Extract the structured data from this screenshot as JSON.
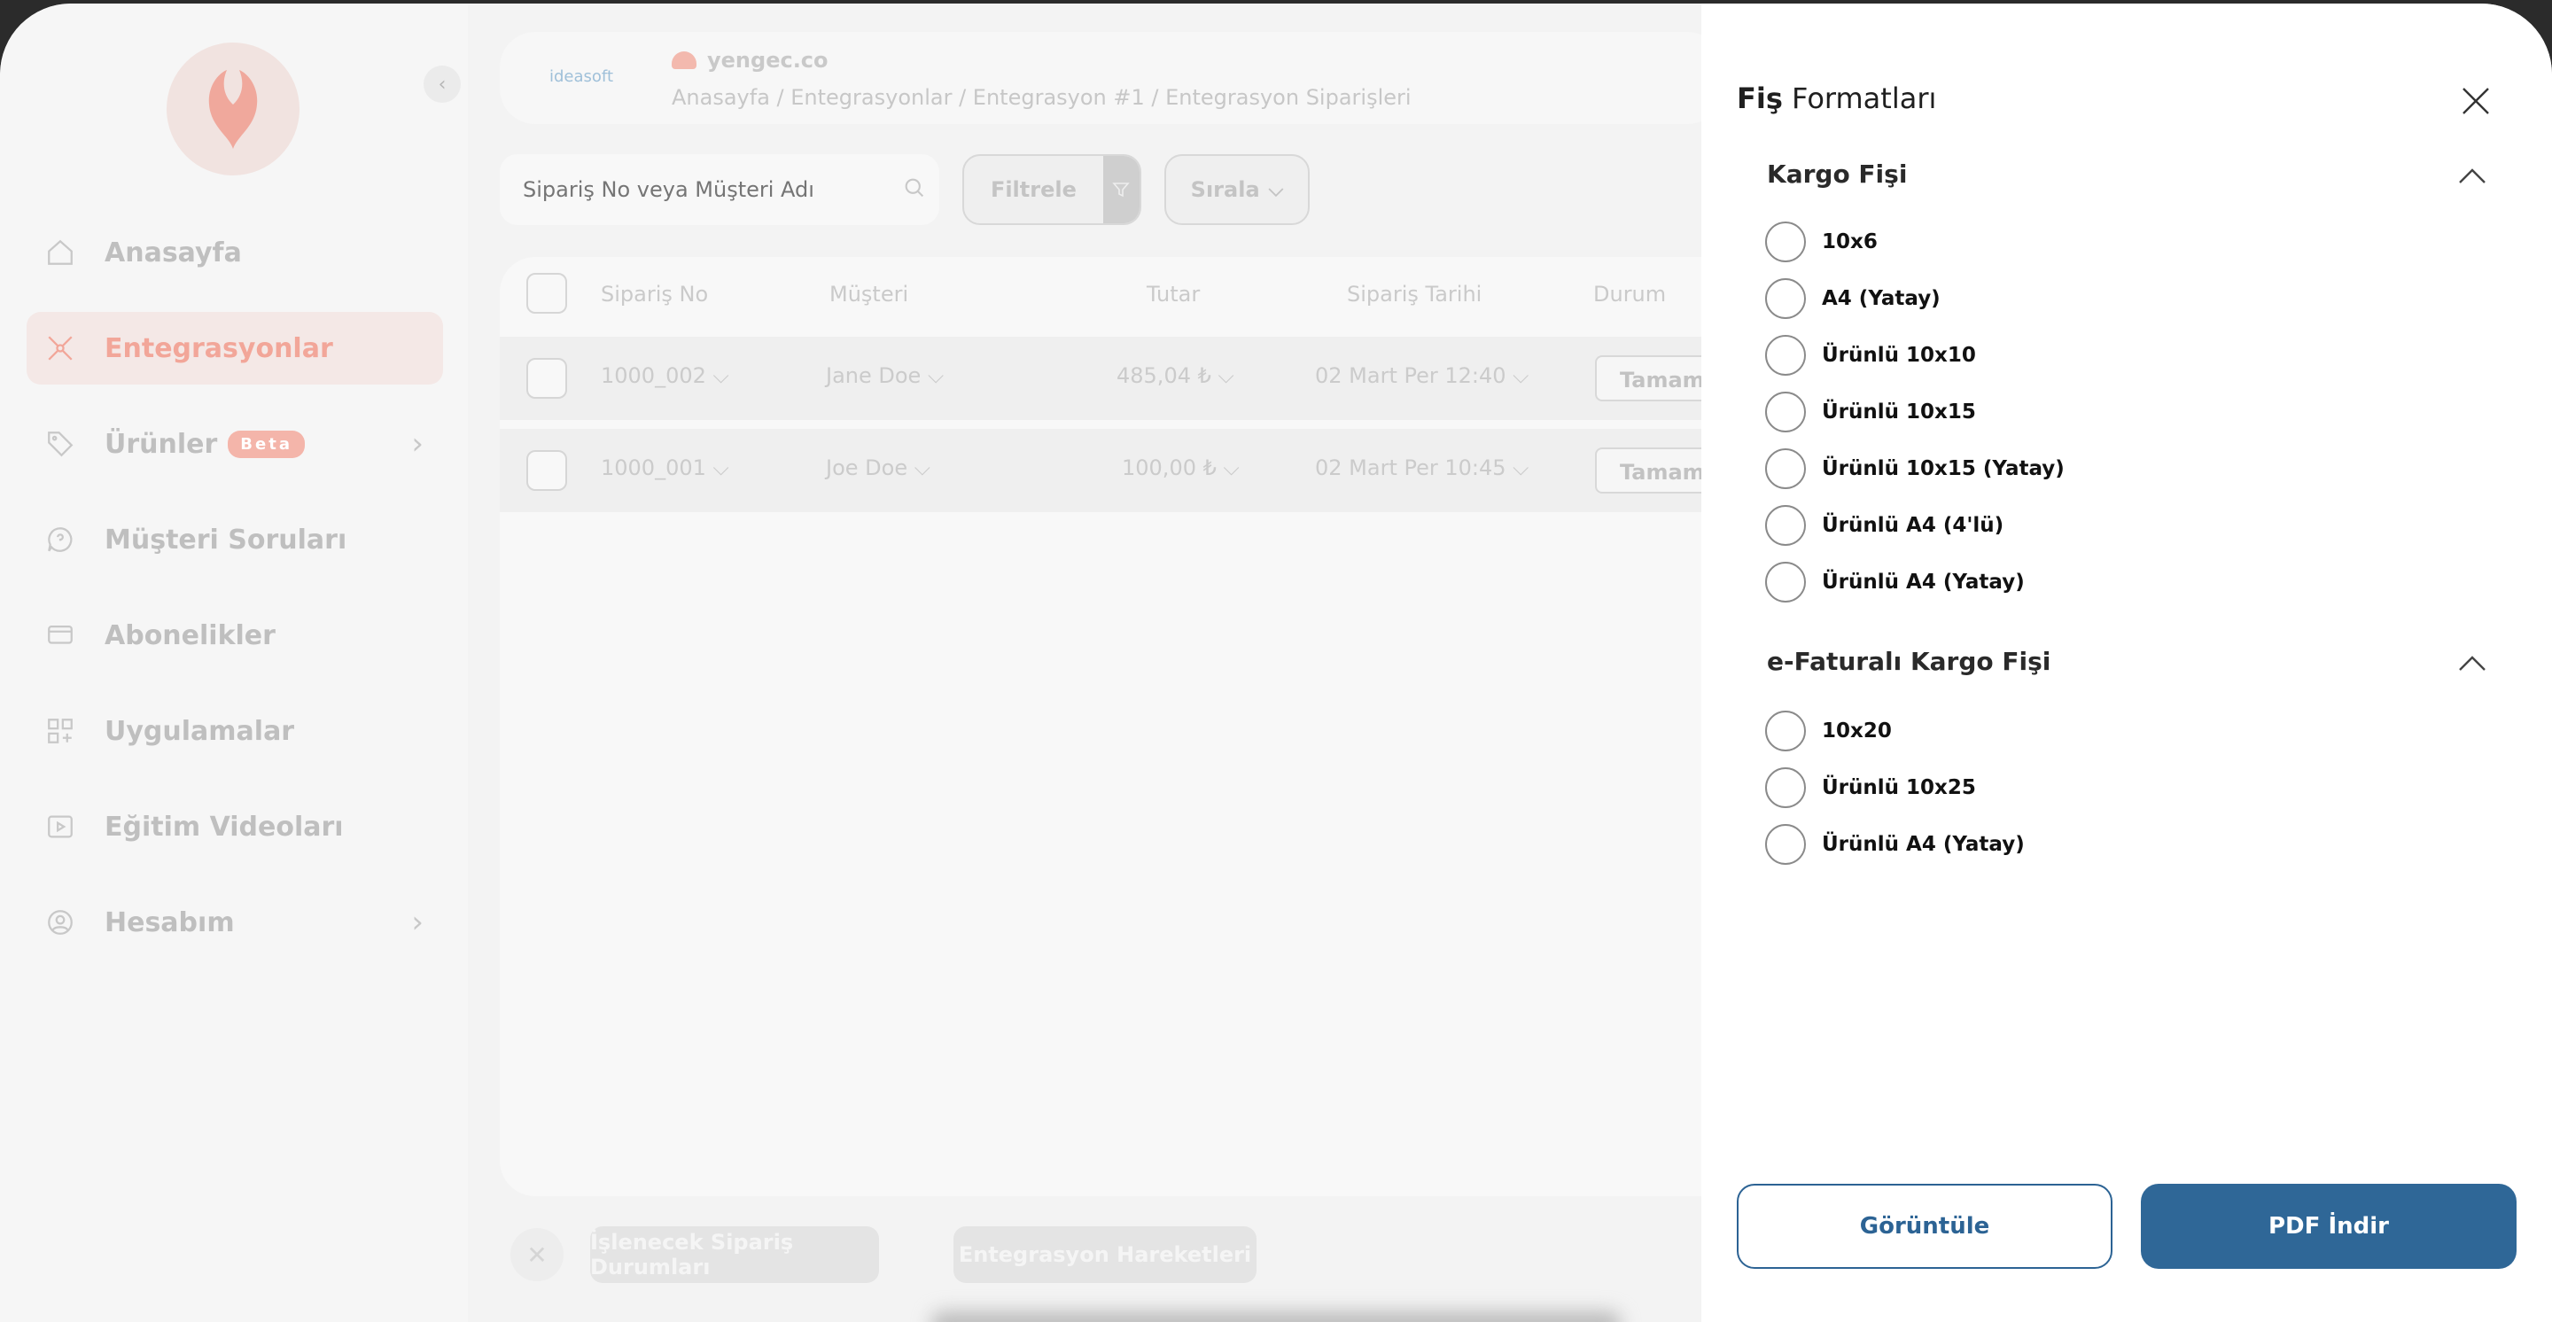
{
  "sidebar": {
    "items": [
      {
        "label": "Anasayfa",
        "icon": "home-icon"
      },
      {
        "label": "Entegrasyonlar",
        "icon": "integration-icon",
        "active": true
      },
      {
        "label": "Ürünler",
        "icon": "tag-icon",
        "badge": "Beta"
      },
      {
        "label": "Müşteri Soruları",
        "icon": "question-icon"
      },
      {
        "label": "Abonelikler",
        "icon": "subscription-icon"
      },
      {
        "label": "Uygulamalar",
        "icon": "apps-icon"
      },
      {
        "label": "Eğitim Videoları",
        "icon": "video-icon"
      },
      {
        "label": "Hesabım",
        "icon": "user-icon"
      }
    ]
  },
  "header": {
    "platform": "ideasoft",
    "store_name": "yengec.co",
    "breadcrumb": "Anasayfa / Entegrasyonlar / Entegrasyon #1 / Entegrasyon Siparişleri"
  },
  "toolbar": {
    "search_placeholder": "Sipariş No veya Müşteri Adı",
    "filter_label": "Filtrele",
    "sort_label": "Sırala"
  },
  "table": {
    "headers": [
      "Sipariş No",
      "Müşteri",
      "Tutar",
      "Sipariş Tarihi",
      "Durum"
    ],
    "rows": [
      {
        "order_no": "1000_002",
        "customer": "Jane Doe",
        "amount": "485,04 ₺",
        "date": "02 Mart Per 12:40",
        "status": "Tamamlandı"
      },
      {
        "order_no": "1000_001",
        "customer": "Joe Doe",
        "amount": "100,00 ₺",
        "date": "02 Mart Per 10:45",
        "status": "Tamamlandı"
      }
    ]
  },
  "bottom": {
    "btn1": "İşlenecek Sipariş Durumları",
    "btn2": "Entegrasyon Hareketleri"
  },
  "drawer": {
    "title_bold": "Fiş",
    "title_rest": " Formatları",
    "sections": [
      {
        "title": "Kargo Fişi",
        "options": [
          "10x6",
          "A4 (Yatay)",
          "Ürünlü 10x10",
          "Ürünlü 10x15",
          "Ürünlü 10x15 (Yatay)",
          "Ürünlü A4 (4'lü)",
          "Ürünlü A4 (Yatay)"
        ]
      },
      {
        "title": "e-Faturalı Kargo Fişi",
        "options": [
          "10x20",
          "Ürünlü 10x25",
          "Ürünlü A4 (Yatay)"
        ]
      }
    ],
    "view_button": "Görüntüle",
    "pdf_button": "PDF İndir"
  },
  "colors": {
    "primary": "#2f6797",
    "accent": "#f2a699"
  }
}
